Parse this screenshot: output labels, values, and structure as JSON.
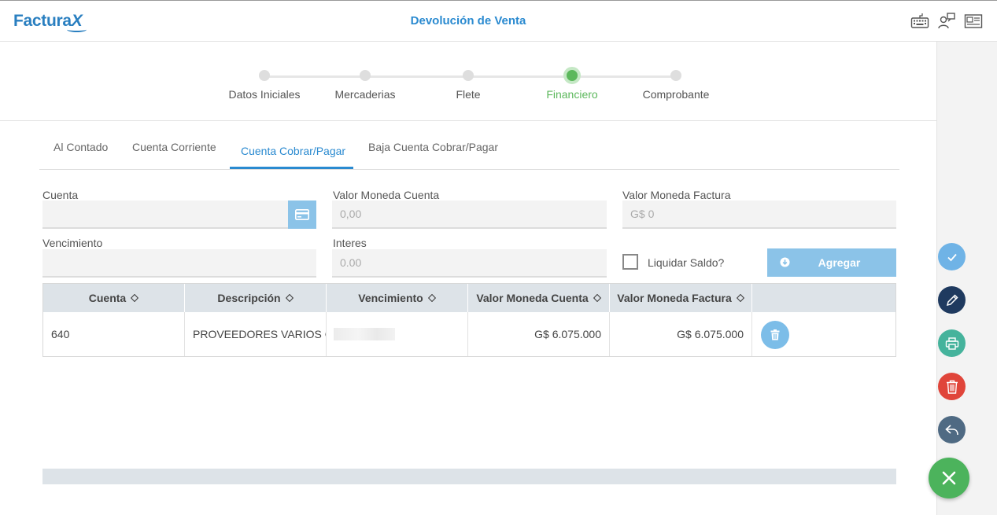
{
  "app": {
    "logo_main": "Factura",
    "logo_x": "X",
    "title": "Devolución de Venta"
  },
  "header_icons": [
    "keyboard-icon",
    "users-icon",
    "newspaper-icon"
  ],
  "stepper": {
    "steps": [
      {
        "label": "Datos Iniciales"
      },
      {
        "label": "Mercaderias"
      },
      {
        "label": "Flete"
      },
      {
        "label": "Financiero"
      },
      {
        "label": "Comprobante"
      }
    ],
    "active_step": "Financiero"
  },
  "tabs": {
    "items": [
      "Al Contado",
      "Cuenta Corriente",
      "Cuenta Cobrar/Pagar",
      "Baja Cuenta Cobrar/Pagar"
    ],
    "active": "Cuenta Cobrar/Pagar"
  },
  "form": {
    "cuenta_label": "Cuenta",
    "cuenta_value": "",
    "valor_moneda_cuenta_label": "Valor Moneda Cuenta",
    "valor_moneda_cuenta_placeholder": "0,00",
    "valor_moneda_factura_label": "Valor Moneda Factura",
    "valor_moneda_factura_placeholder": "G$ 0",
    "vencimiento_label": "Vencimiento",
    "vencimiento_value": "",
    "interes_label": "Interes",
    "interes_placeholder": "0.00",
    "liquidar_saldo_label": "Liquidar Saldo?",
    "liquidar_saldo_checked": false,
    "agregar_label": "Agregar"
  },
  "table": {
    "columns": [
      "Cuenta",
      "Descripción",
      "Vencimiento",
      "Valor Moneda Cuenta",
      "Valor Moneda Factura"
    ],
    "rows": [
      {
        "cuenta": "640",
        "descripcion": "PROVEEDORES VARIOS GS",
        "vencimiento": "",
        "valor_moneda_cuenta": "G$ 6.075.000",
        "valor_moneda_factura": "G$ 6.075.000"
      }
    ]
  },
  "actions": {
    "items": [
      "check-icon",
      "pencil-icon",
      "printer-icon",
      "trash-icon",
      "reply-icon",
      "close-icon"
    ]
  },
  "colors": {
    "primary": "#2a8ad0",
    "active_step": "#5cb85c",
    "button_light": "#8bc3e8",
    "fab_check": "#6fb3e6",
    "fab_edit": "#1f3a5f",
    "fab_print": "#45b39c",
    "fab_delete": "#e0453a",
    "fab_back": "#4f6a83",
    "fab_close": "#4cb35c"
  }
}
